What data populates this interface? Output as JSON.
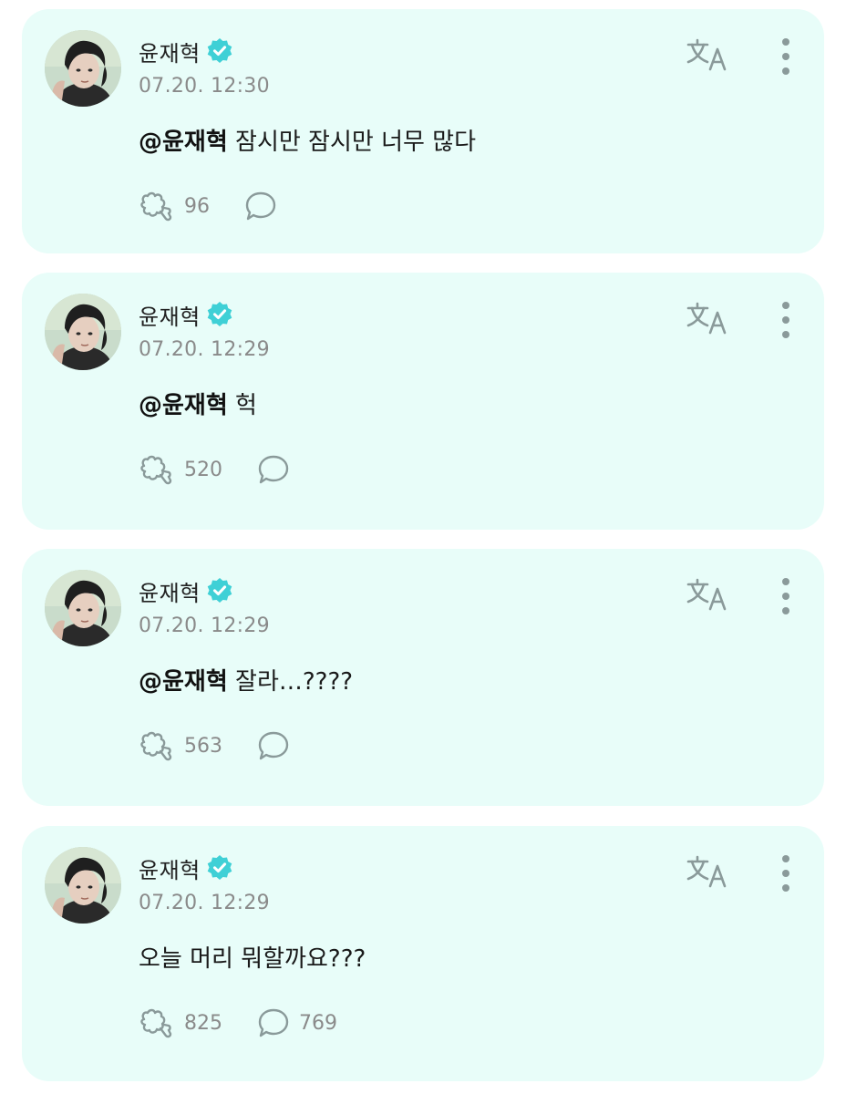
{
  "colors": {
    "card_background": "#e8fdf9",
    "verified_badge": "#3fd0d6",
    "icon_gray": "#8a9a9a"
  },
  "posts": [
    {
      "author": "윤재혁",
      "timestamp": "07.20. 12:30",
      "mention": "@윤재혁",
      "text": " 잠시만 잠시만 너무 많다",
      "likes": "96",
      "comments": ""
    },
    {
      "author": "윤재혁",
      "timestamp": "07.20. 12:29",
      "mention": "@윤재혁",
      "text": " 헉",
      "likes": "520",
      "comments": ""
    },
    {
      "author": "윤재혁",
      "timestamp": "07.20. 12:29",
      "mention": "@윤재혁",
      "text": " 잘라…????",
      "likes": "563",
      "comments": ""
    },
    {
      "author": "윤재혁",
      "timestamp": "07.20. 12:29",
      "mention": "",
      "text": "오늘 머리 뭐할까요???",
      "likes": "825",
      "comments": "769"
    }
  ],
  "icons": {
    "verified": "verified-badge-icon",
    "translate": "translate-icon",
    "more": "more-vertical-icon",
    "like": "heart-hand-icon",
    "comment": "speech-bubble-icon"
  }
}
